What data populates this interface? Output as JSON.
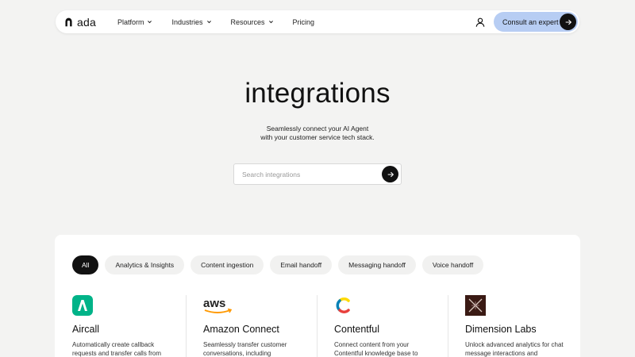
{
  "brand": {
    "logo_text": "ada"
  },
  "nav": {
    "items": [
      {
        "label": "Platform",
        "dropdown": true
      },
      {
        "label": "Industries",
        "dropdown": true
      },
      {
        "label": "Resources",
        "dropdown": true
      },
      {
        "label": "Pricing",
        "dropdown": false
      }
    ],
    "cta_label": "Consult an expert"
  },
  "hero": {
    "title": "integrations",
    "subtitle_line1": "Seamlessly connect your AI Agent",
    "subtitle_line2": "with your customer service tech stack."
  },
  "search": {
    "placeholder": "Search integrations"
  },
  "filters": [
    {
      "label": "All",
      "active": true
    },
    {
      "label": "Analytics & Insights",
      "active": false
    },
    {
      "label": "Content ingestion",
      "active": false
    },
    {
      "label": "Email handoff",
      "active": false
    },
    {
      "label": "Messaging handoff",
      "active": false
    },
    {
      "label": "Voice handoff",
      "active": false
    }
  ],
  "integrations": [
    {
      "name": "Aircall",
      "desc": "Automatically create callback requests and transfer calls from",
      "icon": "aircall-logo"
    },
    {
      "name": "Amazon Connect",
      "desc": "Seamlessly transfer customer conversations, including",
      "icon": "aws-logo"
    },
    {
      "name": "Contentful",
      "desc": "Connect content from your Contentful knowledge base to",
      "icon": "contentful-logo"
    },
    {
      "name": "Dimension Labs",
      "desc": "Unlock advanced analytics for chat message interactions and",
      "icon": "dimension-labs-logo"
    }
  ],
  "colors": {
    "page_bg": "#f3f3f2",
    "cta_bg": "#b7cdf3",
    "dark": "#111111",
    "aircall_green": "#00b388",
    "aws_orange": "#ff9900"
  }
}
